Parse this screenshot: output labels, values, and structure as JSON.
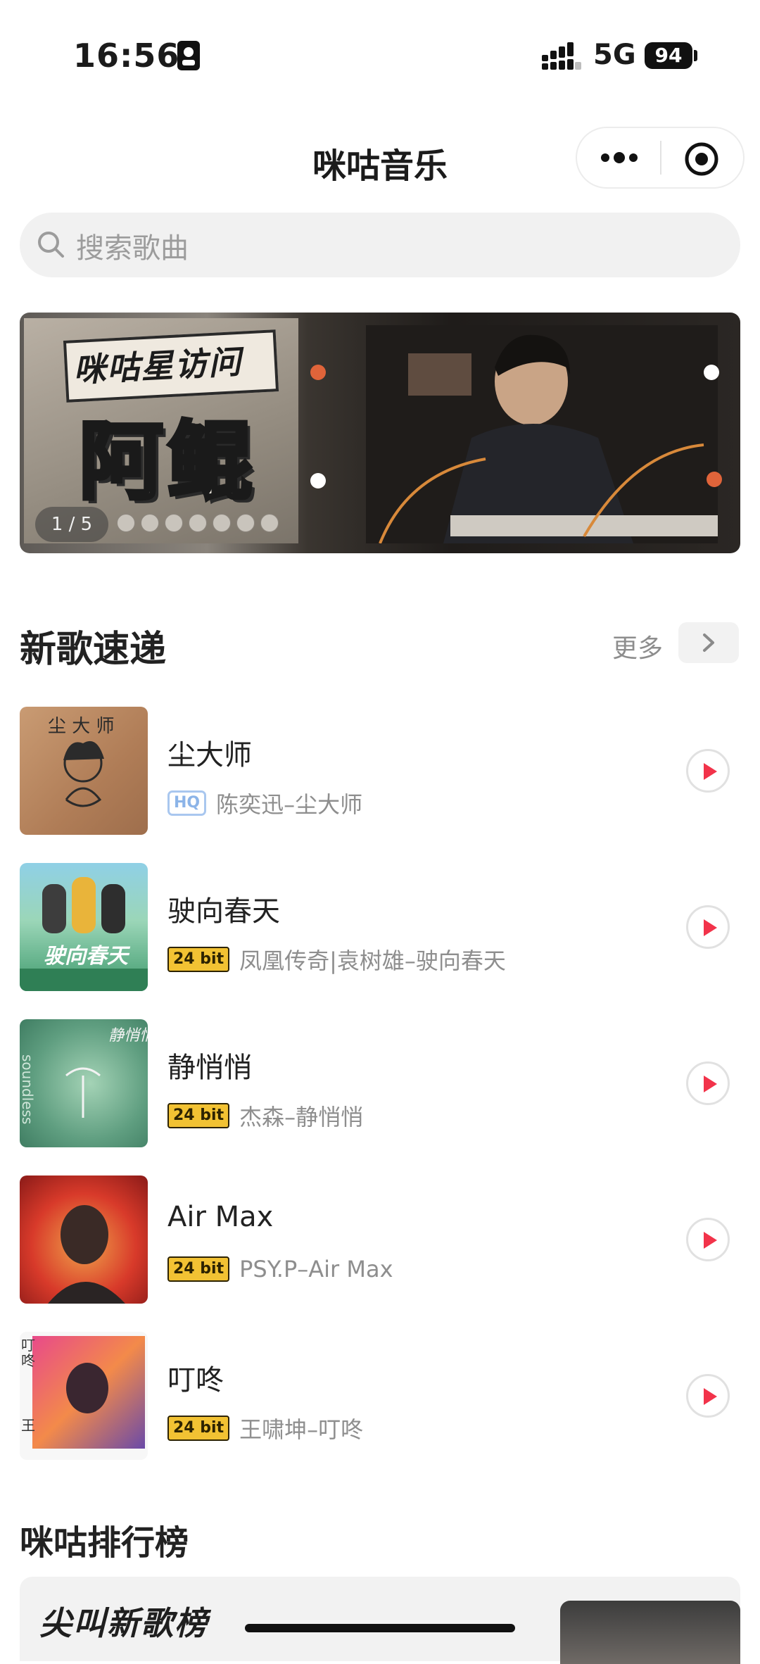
{
  "status_bar": {
    "time": "16:56",
    "network": "5G",
    "battery": "94"
  },
  "nav": {
    "title": "咪咕音乐",
    "more_icon": "more-dots-icon",
    "close_icon": "target-icon"
  },
  "search": {
    "placeholder": "搜索歌曲",
    "icon": "search-icon"
  },
  "banner": {
    "tag": "咪咕星访问",
    "name": "阿鲲",
    "counter": "1 / 5",
    "pages": 5
  },
  "new_songs": {
    "title": "新歌速递",
    "more": "更多",
    "items": [
      {
        "title": "尘大师",
        "badge": "HQ",
        "artist": "陈奕迅–尘大师"
      },
      {
        "title": "驶向春天",
        "badge": "24 bit",
        "artist": "凤凰传奇|袁树雄–驶向春天"
      },
      {
        "title": "静悄悄",
        "badge": "24 bit",
        "artist": "杰森–静悄悄"
      },
      {
        "title": "Air Max",
        "badge": "24 bit",
        "artist": "PSY.P–Air Max"
      },
      {
        "title": "叮咚",
        "badge": "24 bit",
        "artist": "王啸坤–叮咚"
      }
    ]
  },
  "charts": {
    "title": "咪咕排行榜",
    "card_title": "尖叫新歌榜"
  },
  "colors": {
    "accent": "#f2334a",
    "bit_badge": "#f2c233",
    "hq_badge": "#8cb4e8"
  }
}
